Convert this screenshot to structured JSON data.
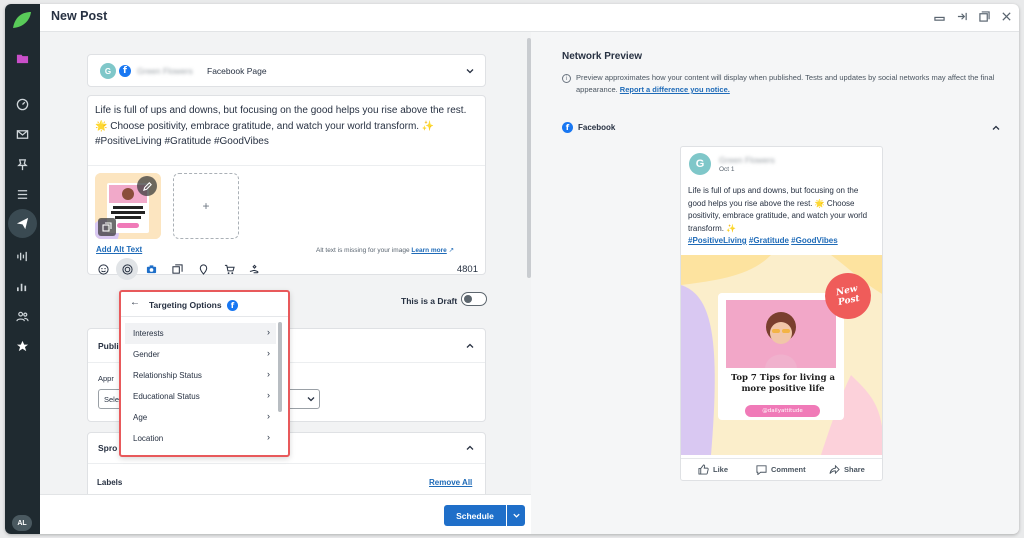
{
  "window": {
    "title": "New Post"
  },
  "rail": {
    "avatar_initials": "AL"
  },
  "account": {
    "avatar_letter": "G",
    "name": "Green Flowers",
    "type": "Facebook Page"
  },
  "composer": {
    "text_line1": "Life is full of ups and downs, but focusing on the good helps you rise above the rest.",
    "text_line2": "🌟 Choose positivity, embrace gratitude, and watch your world transform. ✨",
    "text_line3": "#PositiveLiving #Gratitude #GoodVibes",
    "add_media": "+",
    "alt_link": "Add Alt Text",
    "alt_msg": "Alt text is missing for your image",
    "alt_learn": "Learn more",
    "char_count": "4801"
  },
  "draft": {
    "label": "This is a Draft"
  },
  "targeting": {
    "title": "Targeting Options",
    "back": "←",
    "items": [
      {
        "label": "Interests"
      },
      {
        "label": "Gender"
      },
      {
        "label": "Relationship Status"
      },
      {
        "label": "Educational Status"
      },
      {
        "label": "Age"
      },
      {
        "label": "Location"
      }
    ]
  },
  "sections": {
    "publishing_partial": "Publi",
    "approval_partial": "Appr",
    "select_partial": "Sele",
    "sprout_partial": "Spro",
    "labels": "Labels",
    "remove_all": "Remove All"
  },
  "footer": {
    "schedule": "Schedule"
  },
  "preview_pane": {
    "title": "Network Preview",
    "info": "Preview approximates how your content will display when published. Tests and updates by social networks may affect the final appearance.",
    "info_link": "Report a difference you notice.",
    "network": "Facebook"
  },
  "fb_preview": {
    "avatar_letter": "G",
    "name": "Green Flowers",
    "date": "Oct 1",
    "text_a": "Life is full of ups and downs, but focusing on the good helps you rise above the rest. 🌟 Choose positivity, embrace gratitude, and watch your world transform. ✨",
    "tag1": "#PositiveLiving",
    "tag2": "#Gratitude",
    "tag3": "#GoodVibes",
    "image_badge": "New Post",
    "image_headline": "Top 7 Tips for living a more positive life",
    "image_handle": "@dailyattitude",
    "like": "Like",
    "comment": "Comment",
    "share": "Share"
  },
  "colors": {
    "accent": "#1f6fc9",
    "highlight_border": "#e8595b",
    "rail": "#1f2a30",
    "facebook": "#1877f2"
  }
}
